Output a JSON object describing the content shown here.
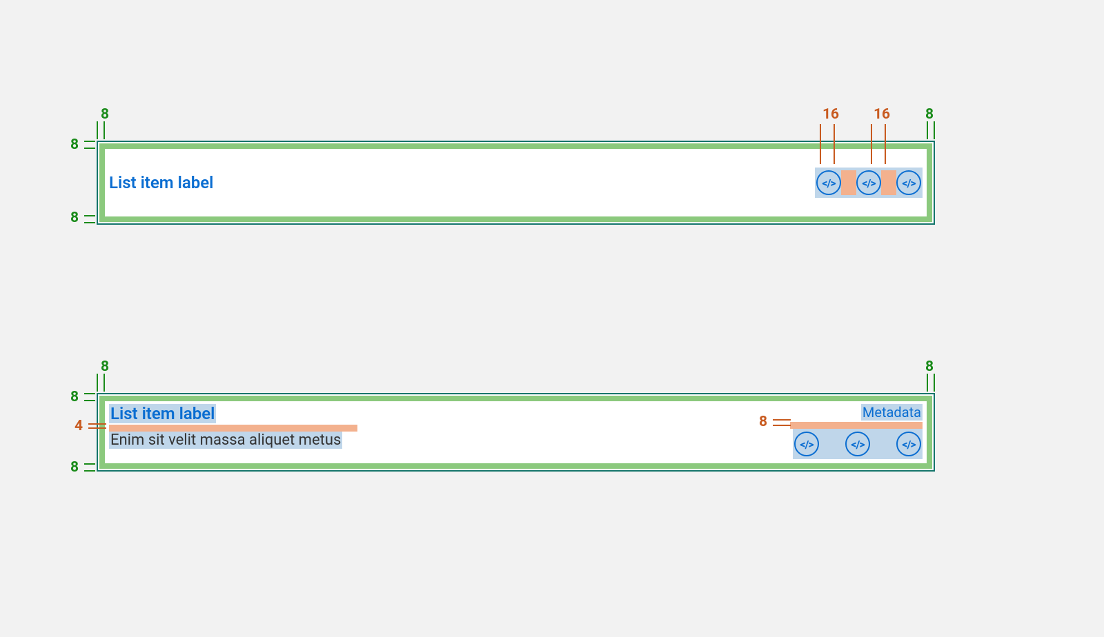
{
  "spec1": {
    "label": "List item label",
    "padding": {
      "top": "8",
      "right": "8",
      "bottom": "8",
      "left": "8"
    },
    "icon_gap": "16"
  },
  "spec2": {
    "label": "List item label",
    "description": "Enim sit velit massa aliquet metus",
    "metadata": "Metadata",
    "padding": {
      "top": "8",
      "right": "8",
      "bottom": "8",
      "left": "8"
    },
    "label_desc_gap": "4",
    "meta_icons_gap": "8"
  },
  "icon_name": "code-icon"
}
